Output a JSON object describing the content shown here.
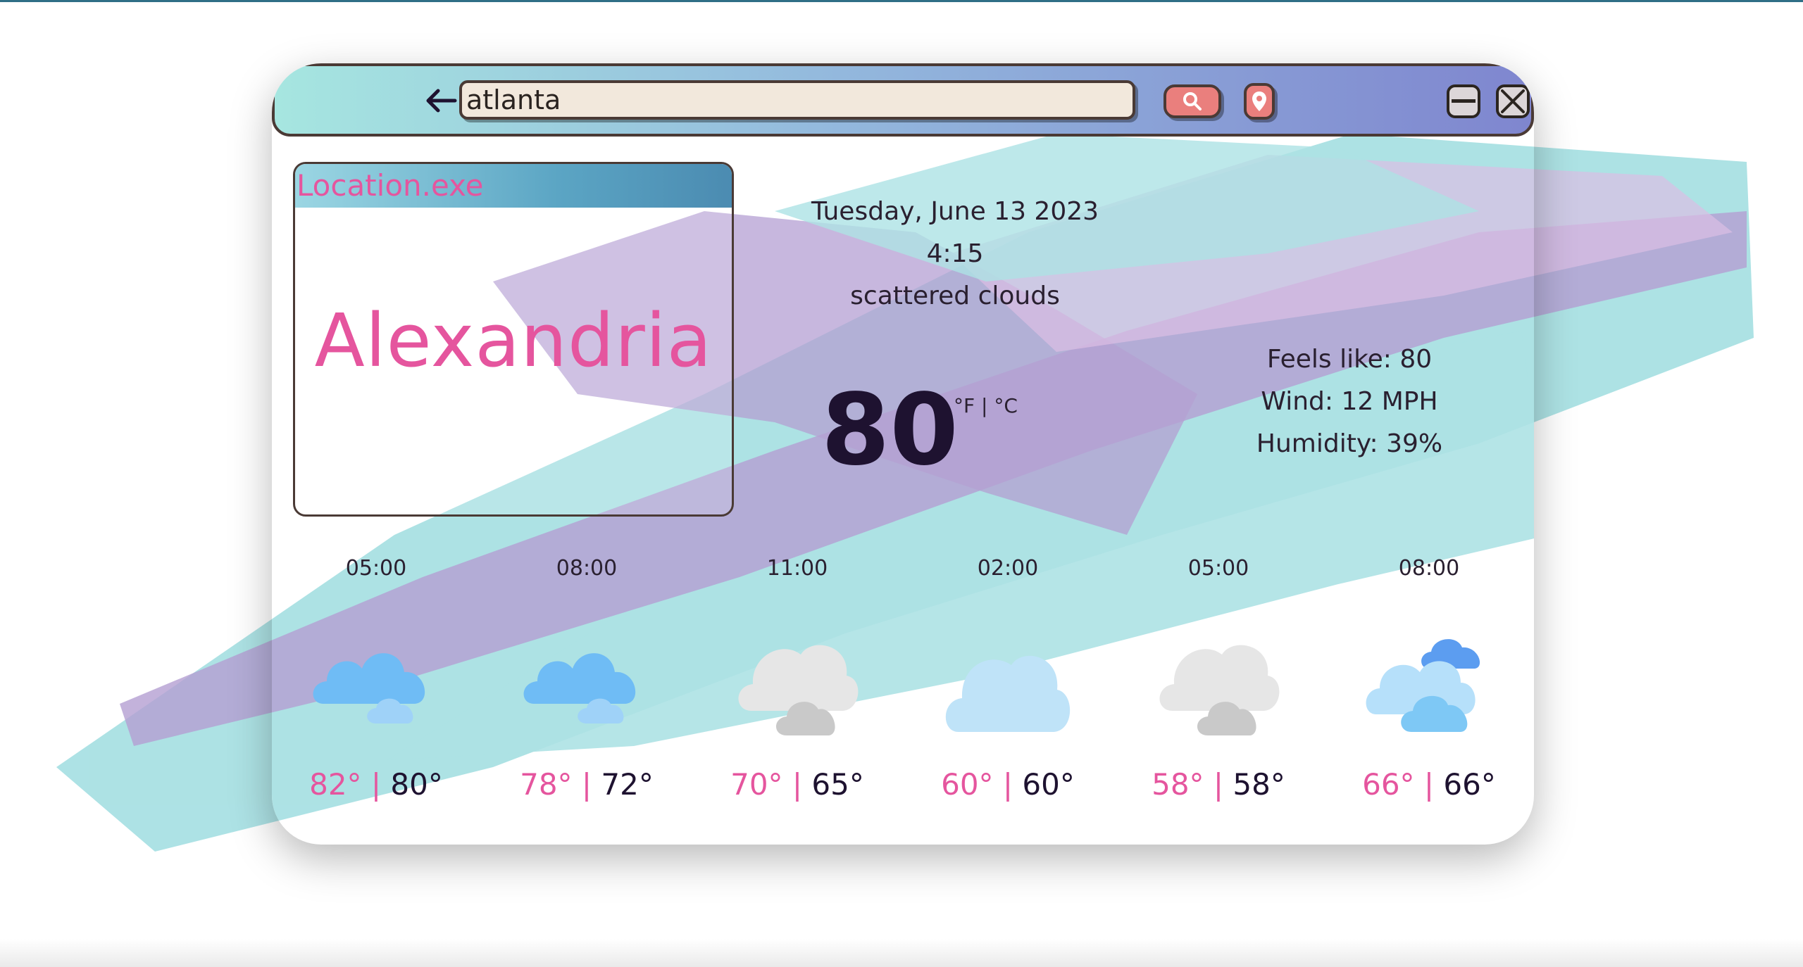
{
  "search": {
    "value": "atlanta",
    "placeholder": ""
  },
  "location_panel": {
    "title": "Location.exe",
    "city": "Alexandria"
  },
  "current": {
    "date": "Tuesday, June 13 2023",
    "time": "4:15",
    "description": "scattered clouds",
    "temperature": "80",
    "units": "°F | °C",
    "feels_like": "Feels like: 80",
    "wind": "Wind: 12 MPH",
    "humidity": "Humidity: 39%"
  },
  "forecast": [
    {
      "time": "05:00",
      "high": "82°",
      "low": "80°",
      "icon": "cloud-blue-icon"
    },
    {
      "time": "08:00",
      "high": "78°",
      "low": "72°",
      "icon": "cloud-blue-icon"
    },
    {
      "time": "11:00",
      "high": "70°",
      "low": "65°",
      "icon": "cloud-gray-icon"
    },
    {
      "time": "02:00",
      "high": "60°",
      "low": "60°",
      "icon": "cloud-lightblue-icon"
    },
    {
      "time": "05:00",
      "high": "58°",
      "low": "58°",
      "icon": "cloud-gray-icon"
    },
    {
      "time": "08:00",
      "high": "66°",
      "low": "66°",
      "icon": "clouds-multi-icon"
    }
  ],
  "colors": {
    "accent_pink": "#e5559e",
    "titlebar_start": "#a6e6e0",
    "titlebar_end": "#7f86cf",
    "button_red": "#ea7f7d",
    "brush_teal": "#9fdde0",
    "brush_purple": "#a78fcb"
  }
}
